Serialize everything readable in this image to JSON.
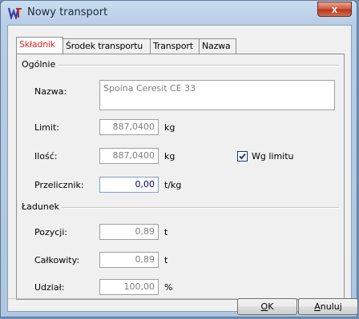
{
  "window": {
    "title": "Nowy transport",
    "close_label": "x"
  },
  "tabs": [
    {
      "label": "Składnik",
      "active": true
    },
    {
      "label": "Środek transportu",
      "active": false
    },
    {
      "label": "Transport",
      "active": false
    },
    {
      "label": "Nazwa",
      "active": false
    }
  ],
  "general": {
    "header": "Ogólnie",
    "name_label": "Nazwa:",
    "name_value": "Spoina Ceresit CE 33",
    "limit_label": "Limit:",
    "limit_value": "887,0400",
    "limit_unit": "kg",
    "qty_label": "Ilość:",
    "qty_value": "887,0400",
    "qty_unit": "kg",
    "checkbox_label": "Wg limitu",
    "checkbox_checked": true,
    "factor_label": "Przelicznik:",
    "factor_value": "0,00",
    "factor_unit": "t/kg"
  },
  "cargo": {
    "header": "Ładunek",
    "positions_label": "Pozycji:",
    "positions_value": "0,89",
    "positions_unit": "t",
    "total_label": "Całkowity:",
    "total_value": "0,89",
    "total_unit": "t",
    "share_label": "Udział:",
    "share_value": "100,00",
    "share_unit": "%"
  },
  "buttons": {
    "ok_key": "O",
    "ok_rest": "K",
    "cancel_key": "A",
    "cancel_rest": "nuluj"
  },
  "colors": {
    "active_tab": "#e02020",
    "editable_text": "#00008b",
    "disabled_text": "#808080"
  }
}
